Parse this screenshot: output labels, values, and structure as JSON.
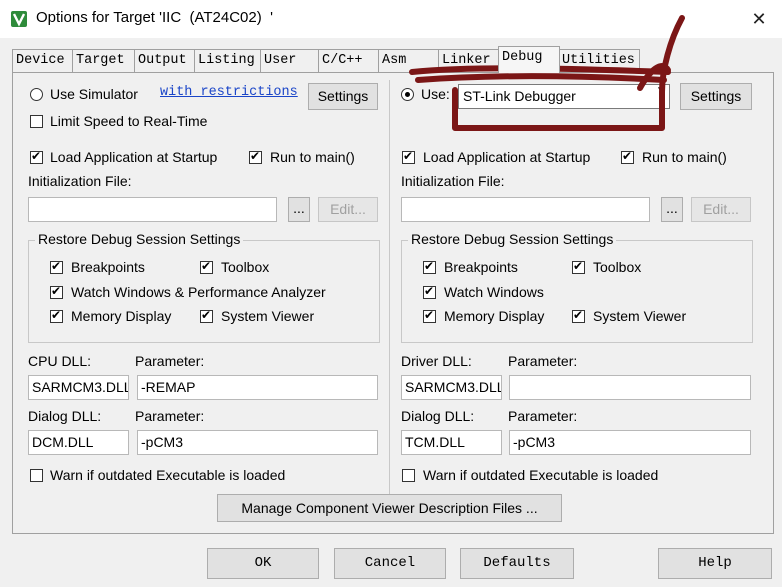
{
  "window": {
    "title": "Options for Target 'IIC  (AT24C02)  '",
    "close_symbol": "✕"
  },
  "tabs": [
    {
      "label": "Device"
    },
    {
      "label": "Target"
    },
    {
      "label": "Output"
    },
    {
      "label": "Listing"
    },
    {
      "label": "User"
    },
    {
      "label": "C/C++"
    },
    {
      "label": "Asm"
    },
    {
      "label": "Linker"
    },
    {
      "label": "Debug"
    },
    {
      "label": "Utilities"
    }
  ],
  "left": {
    "use_simulator_label": "Use Simulator",
    "with_restrictions_link": "with restrictions",
    "settings_button": "Settings",
    "limit_speed_label": "Limit Speed to Real-Time",
    "load_app_label": "Load Application at Startup",
    "run_to_main_label": "Run to main()",
    "init_file_label": "Initialization File:",
    "browse_button": "...",
    "edit_button": "Edit...",
    "restore_group_title": "Restore Debug Session Settings",
    "breakpoints_label": "Breakpoints",
    "toolbox_label": "Toolbox",
    "watch_label": "Watch Windows & Performance Analyzer",
    "memory_label": "Memory Display",
    "sysviewer_label": "System Viewer",
    "cpu_dll_label": "CPU DLL:",
    "cpu_dll_value": "SARMCM3.DLL",
    "param_label_1": "Parameter:",
    "cpu_param_value": "-REMAP",
    "dialog_dll_label": "Dialog DLL:",
    "dialog_dll_value": "DCM.DLL",
    "param_label_2": "Parameter:",
    "dialog_param_value": "-pCM3",
    "warn_label": "Warn if outdated Executable is loaded"
  },
  "right": {
    "use_label": "Use:",
    "debugger_value": "ST-Link Debugger",
    "settings_button": "Settings",
    "load_app_label": "Load Application at Startup",
    "run_to_main_label": "Run to main()",
    "init_file_label": "Initialization File:",
    "browse_button": "...",
    "edit_button": "Edit...",
    "restore_group_title": "Restore Debug Session Settings",
    "breakpoints_label": "Breakpoints",
    "toolbox_label": "Toolbox",
    "watch_label": "Watch Windows",
    "memory_label": "Memory Display",
    "sysviewer_label": "System Viewer",
    "driver_dll_label": "Driver DLL:",
    "driver_dll_value": "SARMCM3.DLL",
    "param_label_1": "Parameter:",
    "driver_param_value": "",
    "dialog_dll_label": "Dialog DLL:",
    "dialog_dll_value": "TCM.DLL",
    "param_label_2": "Parameter:",
    "dialog_param_value": "-pCM3",
    "warn_label": "Warn if outdated Executable is loaded"
  },
  "manage_button": "Manage Component Viewer Description Files ...",
  "footer": {
    "ok": "OK",
    "cancel": "Cancel",
    "defaults": "Defaults",
    "help": "Help"
  },
  "colors": {
    "annotation": "#7b1616",
    "accent_icon": "#2e8b3a"
  }
}
